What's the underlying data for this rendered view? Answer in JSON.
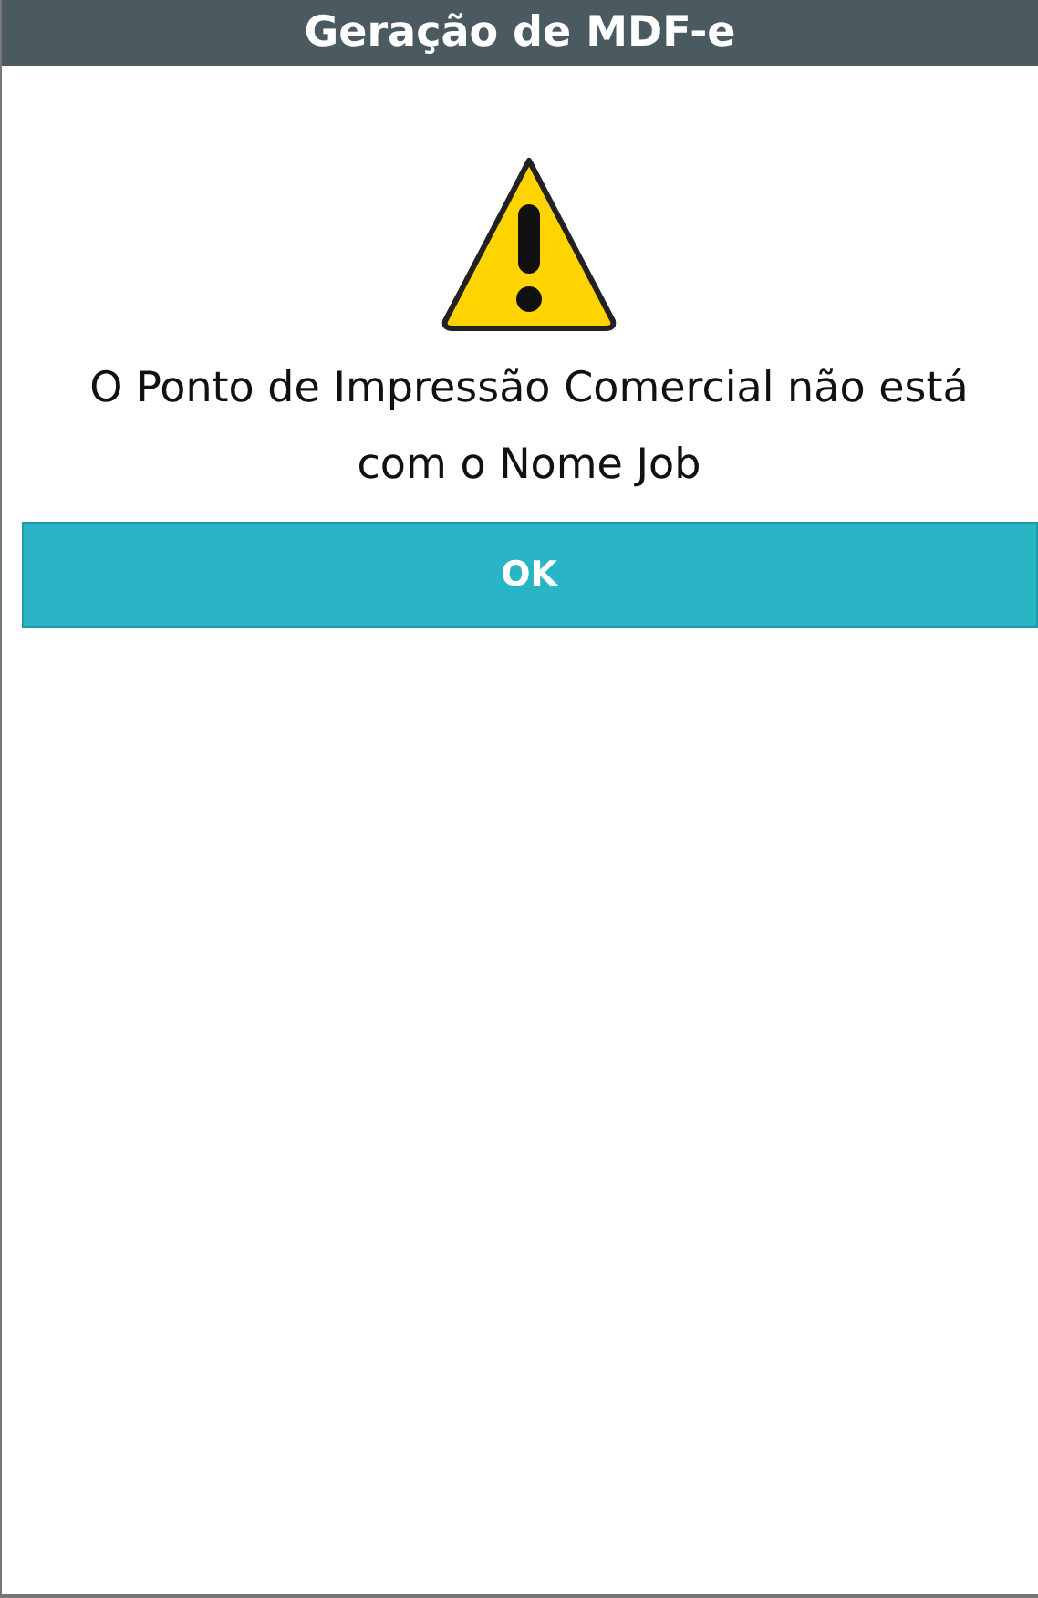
{
  "window": {
    "title": "Geração de MDF-e"
  },
  "message": "O Ponto de Impressão Comercial não está com o Nome Job",
  "buttons": [
    "OK"
  ]
}
